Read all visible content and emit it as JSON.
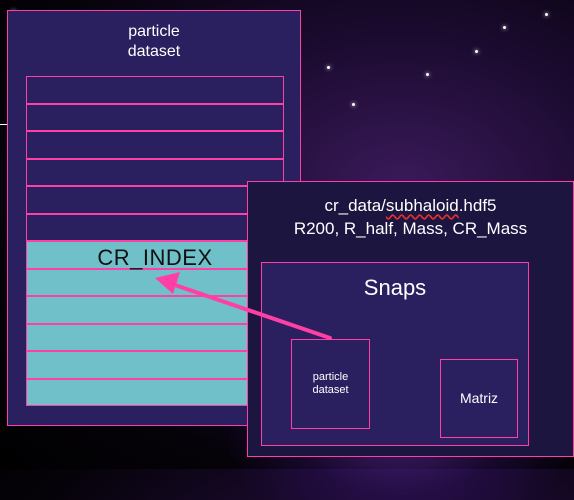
{
  "left_panel": {
    "title_line1": "particle",
    "title_line2": "dataset",
    "highlight_label": "CR_INDEX"
  },
  "right_panel": {
    "file_prefix": "cr_data/",
    "file_underlined": "subhaloid",
    "file_suffix": ".hdf5",
    "fields": "R200, R_half, Mass, CR_Mass"
  },
  "snaps": {
    "title": "Snaps",
    "particle_line1": "particle",
    "particle_line2": "dataset",
    "matriz_label": "Matriz"
  },
  "colors": {
    "panel_fill": "#2a2060",
    "border": "#ff3fa6",
    "highlight_fill": "#6fc0c8",
    "arrow": "#ff3fa6"
  }
}
